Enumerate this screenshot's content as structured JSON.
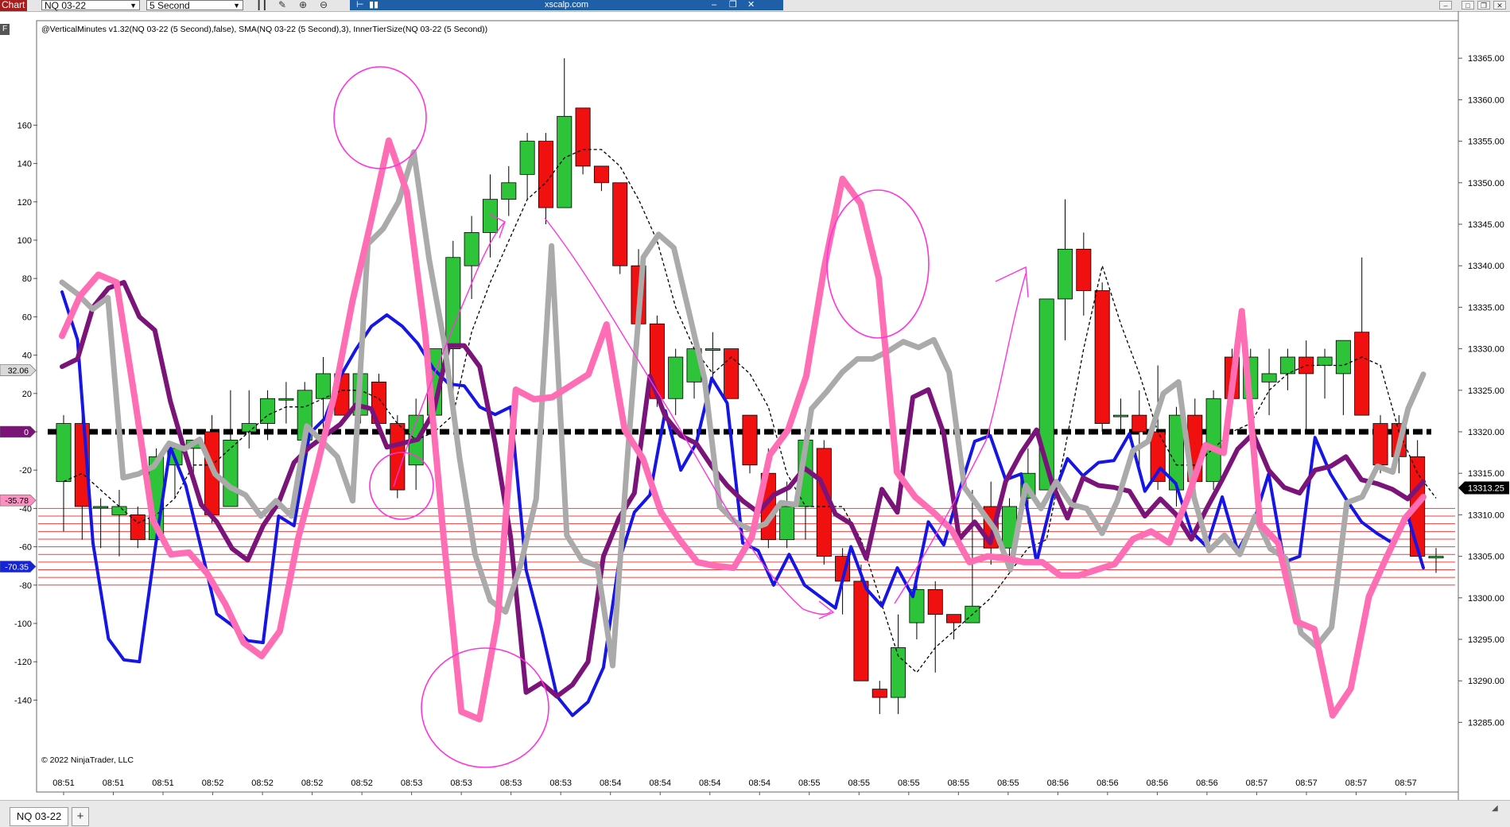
{
  "app": {
    "tab_label": "Chart",
    "instrument_selector": "NQ 03-22",
    "interval_selector": "5 Second",
    "remote_title": "xscalp.com"
  },
  "indicator_caption": "@VerticalMinutes v1.32(NQ 03-22 (5 Second),false), SMA(NQ 03-22 (5 Second),3), InnerTierSize(NQ 03-22 (5 Second))",
  "copyright": "© 2022 NinjaTrader, LLC",
  "panel_badge": "F",
  "bottom_tabs": {
    "instrument_tab": "NQ 03-22",
    "add_tab": "+"
  },
  "left_axis": {
    "ticks": [
      "160",
      "140",
      "120",
      "100",
      "80",
      "60",
      "40",
      "20",
      "0",
      "-20",
      "-40",
      "-60",
      "-80",
      "-100",
      "-120",
      "-140"
    ],
    "markers": [
      {
        "label": "32.06",
        "color": "#d9d9d9",
        "text_color": "#000000"
      },
      {
        "label": "0",
        "color": "#7b1479",
        "text_color": "#ffffff"
      },
      {
        "label": "-35.78",
        "color": "#ff8fc0",
        "text_color": "#000000"
      },
      {
        "label": "-70.35",
        "color": "#1525d6",
        "text_color": "#ffffff"
      }
    ]
  },
  "right_axis": {
    "ticks": [
      "13365.00",
      "13360.00",
      "13355.00",
      "13350.00",
      "13345.00",
      "13340.00",
      "13335.00",
      "13330.00",
      "13325.00",
      "13320.00",
      "13315.00",
      "13310.00",
      "13305.00",
      "13300.00",
      "13295.00",
      "13290.00",
      "13285.00"
    ],
    "price_marker": "13313.25"
  },
  "time_axis": {
    "labels": [
      "08:51",
      "08:51",
      "08:51",
      "08:52",
      "08:52",
      "08:52",
      "08:52",
      "08:53",
      "08:53",
      "08:53",
      "08:53",
      "08:54",
      "08:54",
      "08:54",
      "08:54",
      "08:55",
      "08:55",
      "08:55",
      "08:55",
      "08:55",
      "08:56",
      "08:56",
      "08:56",
      "08:56",
      "08:57",
      "08:57",
      "08:57",
      "08:57"
    ]
  },
  "colors": {
    "up": "#2ec43a",
    "down": "#f01010",
    "wick": "#000000",
    "line_blue": "#1515e6",
    "line_purple": "#7b1479",
    "line_gray": "#aaaaaa",
    "line_pink": "#ff6eb4",
    "annotation": "#ff33dd",
    "zero_line": "#000000",
    "tier_lines": "#f04040"
  },
  "chart_data": {
    "type": "candlestick",
    "interval": "5 Second",
    "instrument": "NQ 03-22",
    "price_range": [
      13281,
      13368
    ],
    "oscillator_range": [
      -143,
      167
    ],
    "tier_levels": [
      -40,
      -44,
      -48,
      -52,
      -56,
      -60,
      -64,
      -68,
      -72,
      -76,
      -80
    ],
    "zero_line": 0,
    "candles": [
      {
        "o": 13314,
        "h": 13322,
        "l": 13308,
        "c": 13321
      },
      {
        "o": 13321,
        "h": 13322,
        "l": 13307,
        "c": 13311
      },
      {
        "o": 13311,
        "h": 13312,
        "l": 13306,
        "c": 13311
      },
      {
        "o": 13310,
        "h": 13313,
        "l": 13305,
        "c": 13311
      },
      {
        "o": 13310,
        "h": 13311,
        "l": 13306,
        "c": 13307
      },
      {
        "o": 13307,
        "h": 13318,
        "l": 13306,
        "c": 13317
      },
      {
        "o": 13316,
        "h": 13318,
        "l": 13312,
        "c": 13318
      },
      {
        "o": 13318,
        "h": 13319,
        "l": 13314,
        "c": 13319
      },
      {
        "o": 13320,
        "h": 13322,
        "l": 13309,
        "c": 13310
      },
      {
        "o": 13311,
        "h": 13325,
        "l": 13311,
        "c": 13319
      },
      {
        "o": 13320,
        "h": 13325,
        "l": 13318,
        "c": 13321
      },
      {
        "o": 13321,
        "h": 13325,
        "l": 13319,
        "c": 13324
      },
      {
        "o": 13324,
        "h": 13326,
        "l": 13321,
        "c": 13324
      },
      {
        "o": 13319,
        "h": 13326,
        "l": 13319,
        "c": 13325
      },
      {
        "o": 13324,
        "h": 13329,
        "l": 13319,
        "c": 13327
      },
      {
        "o": 13327,
        "h": 13329,
        "l": 13322,
        "c": 13322
      },
      {
        "o": 13322,
        "h": 13328,
        "l": 13321,
        "c": 13327
      },
      {
        "o": 13326,
        "h": 13327,
        "l": 13320,
        "c": 13321
      },
      {
        "o": 13321,
        "h": 13322,
        "l": 13312,
        "c": 13313
      },
      {
        "o": 13316,
        "h": 13324,
        "l": 13313,
        "c": 13322
      },
      {
        "o": 13322,
        "h": 13328,
        "l": 13318,
        "c": 13330
      },
      {
        "o": 13330,
        "h": 13343,
        "l": 13322,
        "c": 13341
      },
      {
        "o": 13340,
        "h": 13346,
        "l": 13336,
        "c": 13344
      },
      {
        "o": 13344,
        "h": 13351,
        "l": 13341,
        "c": 13348
      },
      {
        "o": 13348,
        "h": 13352,
        "l": 13346,
        "c": 13350
      },
      {
        "o": 13351,
        "h": 13356,
        "l": 13348,
        "c": 13355
      },
      {
        "o": 13355,
        "h": 13356,
        "l": 13345,
        "c": 13347
      },
      {
        "o": 13347,
        "h": 13365,
        "l": 13347,
        "c": 13358
      },
      {
        "o": 13359,
        "h": 13359,
        "l": 13351,
        "c": 13352
      },
      {
        "o": 13352,
        "h": 13352,
        "l": 13349,
        "c": 13350
      },
      {
        "o": 13350,
        "h": 13350,
        "l": 13339,
        "c": 13340
      },
      {
        "o": 13340,
        "h": 13342,
        "l": 13331,
        "c": 13333
      },
      {
        "o": 13333,
        "h": 13334,
        "l": 13323,
        "c": 13324
      },
      {
        "o": 13324,
        "h": 13330,
        "l": 13322,
        "c": 13329
      },
      {
        "o": 13326,
        "h": 13329,
        "l": 13324,
        "c": 13330
      },
      {
        "o": 13330,
        "h": 13332,
        "l": 13326,
        "c": 13330
      },
      {
        "o": 13330,
        "h": 13330,
        "l": 13324,
        "c": 13324
      },
      {
        "o": 13322,
        "h": 13322,
        "l": 13315,
        "c": 13316
      },
      {
        "o": 13315,
        "h": 13318,
        "l": 13306,
        "c": 13307
      },
      {
        "o": 13307,
        "h": 13314,
        "l": 13306,
        "c": 13311
      },
      {
        "o": 13311,
        "h": 13318,
        "l": 13307,
        "c": 13319
      },
      {
        "o": 13318,
        "h": 13319,
        "l": 13304,
        "c": 13305
      },
      {
        "o": 13305,
        "h": 13306,
        "l": 13298,
        "c": 13302
      },
      {
        "o": 13302,
        "h": 13304,
        "l": 13290,
        "c": 13290
      },
      {
        "o": 13289,
        "h": 13290,
        "l": 13286,
        "c": 13288
      },
      {
        "o": 13288,
        "h": 13298,
        "l": 13286,
        "c": 13294
      },
      {
        "o": 13297,
        "h": 13302,
        "l": 13295,
        "c": 13301
      },
      {
        "o": 13301,
        "h": 13302,
        "l": 13291,
        "c": 13298
      },
      {
        "o": 13298,
        "h": 13298,
        "l": 13295,
        "c": 13297
      },
      {
        "o": 13297,
        "h": 13313,
        "l": 13297,
        "c": 13299
      },
      {
        "o": 13311,
        "h": 13314,
        "l": 13304,
        "c": 13306
      },
      {
        "o": 13306,
        "h": 13312,
        "l": 13303,
        "c": 13311
      },
      {
        "o": 13312,
        "h": 13318,
        "l": 13309,
        "c": 13315
      },
      {
        "o": 13313,
        "h": 13336,
        "l": 13313,
        "c": 13336
      },
      {
        "o": 13336,
        "h": 13348,
        "l": 13331,
        "c": 13342
      },
      {
        "o": 13342,
        "h": 13344,
        "l": 13334,
        "c": 13337
      },
      {
        "o": 13337,
        "h": 13338,
        "l": 13320,
        "c": 13321
      },
      {
        "o": 13322,
        "h": 13324,
        "l": 13320,
        "c": 13322
      },
      {
        "o": 13322,
        "h": 13325,
        "l": 13315,
        "c": 13320
      },
      {
        "o": 13320,
        "h": 13328,
        "l": 13313,
        "c": 13314
      },
      {
        "o": 13313,
        "h": 13323,
        "l": 13311,
        "c": 13322
      },
      {
        "o": 13322,
        "h": 13324,
        "l": 13312,
        "c": 13314
      },
      {
        "o": 13314,
        "h": 13325,
        "l": 13313,
        "c": 13324
      },
      {
        "o": 13329,
        "h": 13330,
        "l": 13323,
        "c": 13324
      },
      {
        "o": 13324,
        "h": 13330,
        "l": 13322,
        "c": 13329
      },
      {
        "o": 13326,
        "h": 13330,
        "l": 13322,
        "c": 13327
      },
      {
        "o": 13327,
        "h": 13330,
        "l": 13325,
        "c": 13329
      },
      {
        "o": 13329,
        "h": 13331,
        "l": 13320,
        "c": 13327
      },
      {
        "o": 13328,
        "h": 13330,
        "l": 13324,
        "c": 13329
      },
      {
        "o": 13327,
        "h": 13330,
        "l": 13322,
        "c": 13331
      },
      {
        "o": 13332,
        "h": 13341,
        "l": 13328,
        "c": 13322
      },
      {
        "o": 13321,
        "h": 13322,
        "l": 13315,
        "c": 13316
      },
      {
        "o": 13321,
        "h": 13322,
        "l": 13315,
        "c": 13317
      },
      {
        "o": 13317,
        "h": 13319,
        "l": 13306,
        "c": 13305
      },
      {
        "o": 13305,
        "h": 13306,
        "l": 13303,
        "c": 13305
      }
    ],
    "sma": [
      13314,
      13315,
      13313,
      13311,
      13309,
      13310,
      13312,
      13316,
      13316,
      13318,
      13320,
      13322,
      13323,
      13323,
      13324,
      13325,
      13325,
      13324,
      13321,
      13319,
      13320,
      13322,
      13332,
      13338,
      13343,
      13348,
      13350,
      13353,
      13354,
      13354,
      13352,
      13348,
      13343,
      13335,
      13330,
      13327,
      13329,
      13327,
      13323,
      13315,
      13311,
      13311,
      13311,
      13307,
      13300,
      13293,
      13291,
      13294,
      13296,
      13298,
      13300,
      13303,
      13306,
      13307,
      13318,
      13330,
      13340,
      13333,
      13327,
      13320,
      13316,
      13316,
      13318,
      13320,
      13321,
      13325,
      13327,
      13328,
      13328,
      13328,
      13329,
      13328,
      13320,
      13315,
      13312
    ],
    "series": [
      {
        "name": "blue",
        "values": [
          73,
          48,
          -58,
          -108,
          -119,
          -120,
          -62,
          -8,
          -28,
          -61,
          -95,
          -101,
          -109,
          -110,
          -44,
          -49,
          -1,
          7,
          29,
          43,
          55,
          61,
          55,
          46,
          33,
          25,
          24,
          13,
          9,
          13,
          -72,
          -103,
          -138,
          -148,
          -141,
          -123,
          -68,
          -42,
          -33,
          11,
          -20,
          -6,
          28,
          15,
          -58,
          -62,
          -80,
          -64,
          -80,
          -86,
          -92,
          -60,
          -82,
          -91,
          -71,
          -86,
          -47,
          -59,
          -31,
          -5,
          -2,
          -25,
          -22,
          -68,
          -35,
          -14,
          -23,
          -16,
          -15,
          -1,
          -31,
          -19,
          -27,
          -52,
          -60,
          -34,
          -62,
          -48,
          -22,
          -68,
          -65,
          -3,
          -22,
          -35,
          -47,
          -53,
          -58,
          -44,
          -71
        ]
      },
      {
        "name": "purple",
        "values": [
          34,
          38,
          65,
          75,
          78,
          60,
          53,
          16,
          -12,
          -38,
          -47,
          -61,
          -67,
          -49,
          -37,
          -16,
          -8,
          -2,
          4,
          14,
          12,
          -8,
          -6,
          -4,
          10,
          45,
          45,
          34,
          -6,
          -55,
          -136,
          -131,
          -138,
          -132,
          -120,
          -65,
          -45,
          -32,
          29,
          8,
          -2,
          -6,
          -18,
          -28,
          -36,
          -42,
          -33,
          -29,
          -19,
          -25,
          -43,
          -48,
          -66,
          -30,
          -42,
          18,
          22,
          -1,
          -56,
          -47,
          -58,
          -26,
          -11,
          1,
          -27,
          -45,
          -24,
          -28,
          -29,
          -31,
          -44,
          -35,
          -43,
          -56,
          -40,
          -25,
          -9,
          -1,
          -20,
          -29,
          -32,
          -20,
          -18,
          -13,
          -25,
          -27,
          -30,
          -35,
          -26
        ]
      },
      {
        "name": "gray",
        "values": [
          78,
          72,
          64,
          70,
          -24,
          -22,
          -18,
          -6,
          -9,
          -4,
          -22,
          -29,
          -33,
          -44,
          -36,
          -44,
          3,
          -5,
          -13,
          -36,
          98,
          106,
          120,
          146,
          90,
          46,
          -14,
          -64,
          -88,
          -94,
          -69,
          -35,
          97,
          -54,
          -67,
          -70,
          -122,
          -10,
          91,
          103,
          96,
          62,
          28,
          -39,
          -47,
          -51,
          -48,
          -37,
          -38,
          12,
          21,
          31,
          38,
          38,
          42,
          47,
          44,
          48,
          31,
          -29,
          -40,
          -51,
          -72,
          -28,
          -40,
          -26,
          -38,
          -40,
          -53,
          -36,
          -10,
          -5,
          20,
          26,
          -34,
          -62,
          -54,
          -64,
          -44,
          -61,
          -66,
          -105,
          -112,
          -102,
          -37,
          -34,
          -18,
          -21,
          12,
          30
        ]
      },
      {
        "name": "pink",
        "values": [
          50,
          71,
          82,
          78,
          18,
          -46,
          -64,
          -63,
          -74,
          -90,
          -110,
          -117,
          -104,
          -56,
          -20,
          19,
          68,
          109,
          152,
          125,
          52,
          -53,
          -146,
          -150,
          -98,
          22,
          17,
          18,
          24,
          30,
          56,
          1,
          -14,
          -42,
          -56,
          -68,
          -70,
          -71,
          -55,
          -12,
          1,
          29,
          86,
          132,
          119,
          80,
          -21,
          -34,
          -42,
          -51,
          -68,
          -65,
          -66,
          -68,
          -68,
          -75,
          -75,
          -72,
          -69,
          -56,
          -52,
          -58,
          -35,
          -7,
          -11,
          63,
          -48,
          -58,
          -99,
          -103,
          -148,
          -134,
          -86,
          -65,
          -45,
          -34
        ]
      }
    ]
  }
}
